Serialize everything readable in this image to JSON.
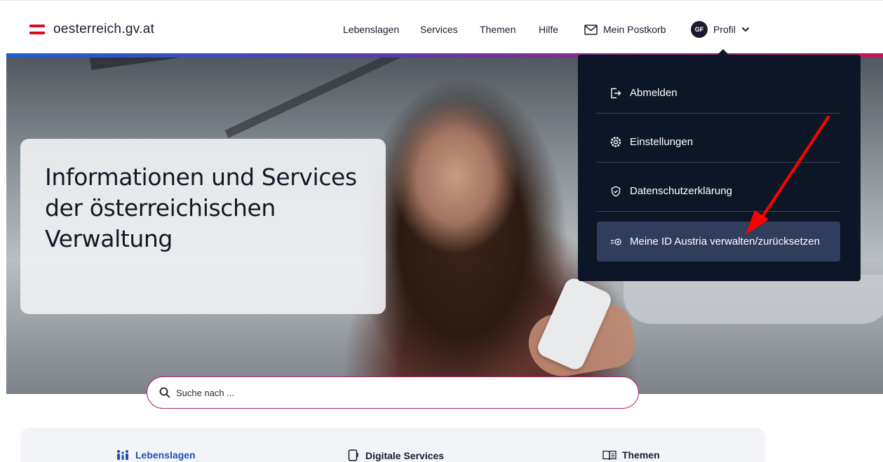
{
  "header": {
    "logo_text": "oesterreich.gv.at",
    "nav": [
      "Lebenslagen",
      "Services",
      "Themen",
      "Hilfe"
    ],
    "postkorb": "Mein Postkorb",
    "avatar_initials": "GF",
    "profil": "Profil"
  },
  "hero": {
    "title": "Informationen und Services der österreichischen Verwaltung"
  },
  "profile_menu": {
    "items": [
      {
        "label": "Abmelden",
        "icon": "logout-icon"
      },
      {
        "label": "Einstellungen",
        "icon": "gear-icon"
      },
      {
        "label": "Datenschutzerklärung",
        "icon": "shield-check-icon"
      },
      {
        "label": "Meine ID Austria verwalten/zurücksetzen",
        "icon": "id-austria-icon"
      }
    ],
    "active_index": 3
  },
  "search": {
    "placeholder": "Suche nach ..."
  },
  "quick_links": [
    {
      "label": "Lebenslagen",
      "icon": "family-icon"
    },
    {
      "label": "Digitale Services",
      "icon": "device-icon"
    },
    {
      "label": "Themen",
      "icon": "book-icon"
    }
  ],
  "colors": {
    "brand_red": "#e10a1c",
    "dropdown_bg": "#0d1626",
    "dropdown_active": "#303d5c",
    "search_border": "#a9236c",
    "lebenslagen_blue": "#1f4fb8",
    "annotation_arrow": "#ff0000"
  }
}
